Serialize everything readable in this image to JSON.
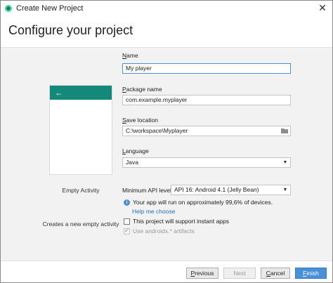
{
  "window": {
    "title": "Create New Project",
    "close_glyph": "✕"
  },
  "header": {
    "heading": "Configure your project"
  },
  "template": {
    "name": "Empty Activity",
    "description": "Creates a new empty activity",
    "back_arrow_glyph": "←",
    "appbar_color": "#14897a"
  },
  "form": {
    "name": {
      "label_mnemonic": "N",
      "label_rest": "ame",
      "value": "My player"
    },
    "package": {
      "label_mnemonic": "P",
      "label_rest": "ackage name",
      "value": "com.example.myplayer"
    },
    "save_location": {
      "label_mnemonic": "S",
      "label_rest": "ave location",
      "value": "C:\\workspace\\Myplayer",
      "icon": "folder-icon"
    },
    "language": {
      "label_mnemonic": "L",
      "label_rest": "anguage",
      "value": "Java"
    },
    "min_api": {
      "label": "Minimum API level",
      "value": "API 16: Android 4.1 (Jelly Bean)"
    },
    "info_text": "Your app will run on approximately 99,6% of devices.",
    "help_link": "Help me choose",
    "instant_apps": {
      "label": "This project will support instant apps",
      "checked": false
    },
    "androidx": {
      "label": "Use androidx.* artifacts",
      "checked": true,
      "disabled": true
    }
  },
  "footer": {
    "previous_mnemonic": "P",
    "previous_rest": "revious",
    "next": "Next",
    "cancel_mnemonic": "C",
    "cancel_rest": "ancel",
    "finish_mnemonic": "F",
    "finish_rest": "inish"
  },
  "colors": {
    "accent": "#4a90d9",
    "link": "#2a6ebb"
  }
}
